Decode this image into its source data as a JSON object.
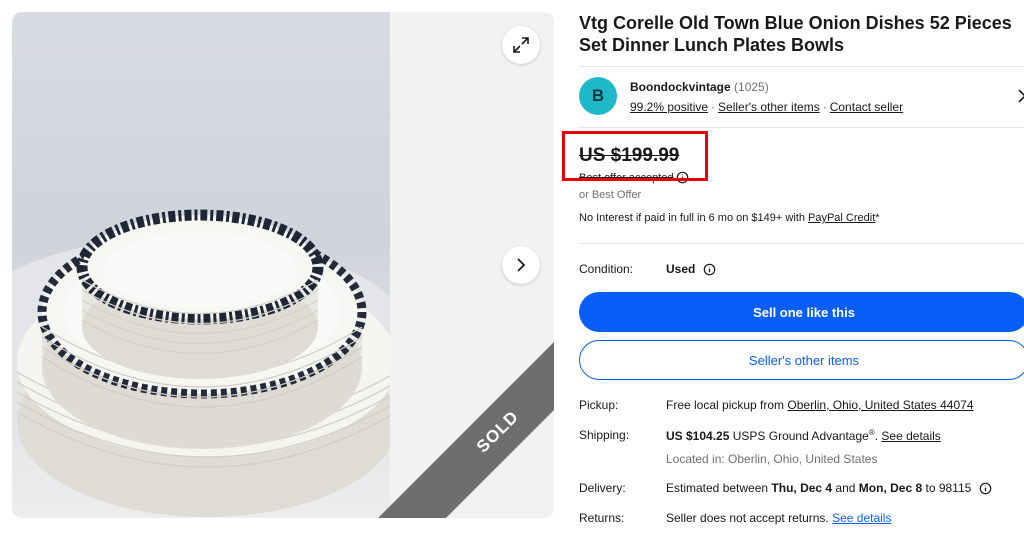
{
  "listing": {
    "title": "Vtg Corelle Old Town Blue Onion Dishes 52 Pieces Set Dinner Lunch Plates Bowls",
    "sold_label": "SOLD"
  },
  "seller": {
    "avatar_letter": "B",
    "name": "Boondockvintage",
    "feedback_count": "(1025)",
    "positive": "99.2% positive",
    "other_items": "Seller's other items",
    "contact": "Contact seller",
    "separator": "·"
  },
  "price": {
    "amount": "US $199.99",
    "best_offer_accepted": "Best offer accepted",
    "or_best_offer": "or Best Offer",
    "credit_text": "No Interest if paid in full in 6 mo on $149+ with ",
    "credit_link": "PayPal Credit",
    "credit_suffix": "*"
  },
  "condition": {
    "label": "Condition:",
    "value": "Used"
  },
  "buttons": {
    "sell": "Sell one like this",
    "other_items": "Seller's other items"
  },
  "pickup": {
    "label": "Pickup:",
    "text": "Free local pickup from ",
    "link": "Oberlin, Ohio, United States 44074"
  },
  "shipping": {
    "label": "Shipping:",
    "amount": "US $104.25",
    "service": " USPS Ground Advantage",
    "reg": "®",
    "dot": ". ",
    "link": "See details",
    "location": "Located in: Oberlin, Ohio, United States"
  },
  "delivery": {
    "label": "Delivery:",
    "prefix": "Estimated between ",
    "start": "Thu, Dec 4",
    "and": " and ",
    "end": "Mon, Dec 8",
    "suffix": " to 98115"
  },
  "returns": {
    "label": "Returns:",
    "text": "Seller does not accept returns. ",
    "link": "See details"
  },
  "icons": {
    "expand": "expand-icon",
    "next": "chevron-right-icon",
    "info": "info-icon",
    "seller_chevron": "chevron-right-icon"
  },
  "colors": {
    "accent": "#0a5ef8",
    "highlight": "#e5000b",
    "avatar": "#1fb8c8",
    "sold_ribbon": "#6e6e6e"
  }
}
